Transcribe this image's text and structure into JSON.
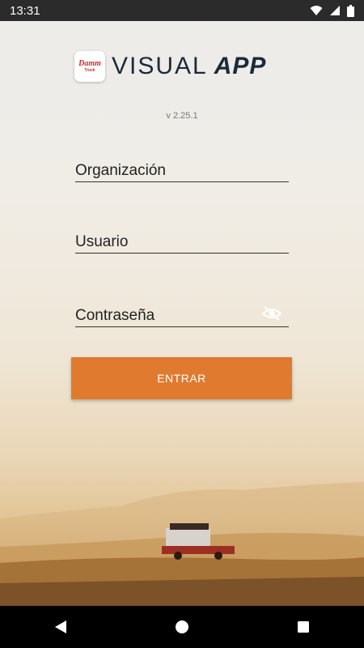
{
  "status_bar": {
    "time": "13:31",
    "icons": [
      "wifi-icon",
      "signal-icon",
      "battery-icon"
    ]
  },
  "header": {
    "logo_brand": "Damm",
    "logo_sub": "Truck",
    "title_light": "VISUAL",
    "title_bold": "APP"
  },
  "version": "v 2.25.1",
  "form": {
    "organization_placeholder": "Organización",
    "user_placeholder": "Usuario",
    "password_placeholder": "Contraseña",
    "password_toggle_icon": "eye-off-icon",
    "submit_label": "ENTRAR"
  },
  "colors": {
    "accent": "#e07a2e",
    "title": "#1b2a3a",
    "logo_red": "#d02a2a"
  },
  "nav_bar": {
    "buttons": [
      "back-icon",
      "home-icon",
      "recents-icon"
    ]
  }
}
